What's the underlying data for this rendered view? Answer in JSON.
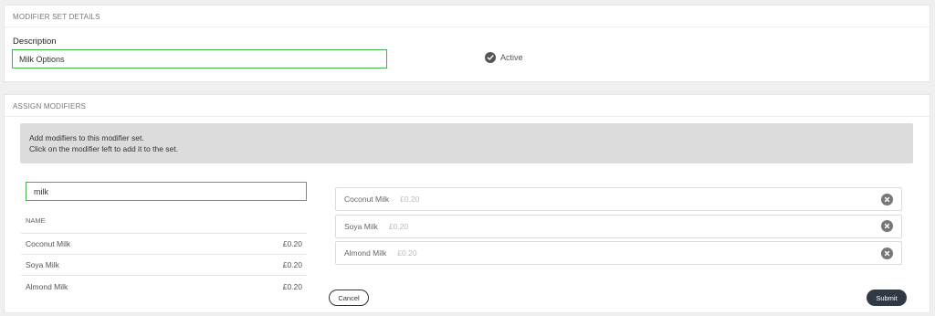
{
  "details": {
    "header": "MODIFIER SET DETAILS",
    "description_label": "Description",
    "description_value": "Milk Options",
    "active_label": "Active"
  },
  "assign": {
    "header": "ASSIGN MODIFIERS",
    "info_line1": "Add modifiers to this modifier set.",
    "info_line2": "Click on the modifier left to add it to the set.",
    "search_value": "milk",
    "list_header": "NAME",
    "available": [
      {
        "name": "Coconut Milk",
        "price": "£0.20"
      },
      {
        "name": "Soya Milk",
        "price": "£0.20"
      },
      {
        "name": "Almond Milk",
        "price": "£0.20"
      }
    ],
    "assigned": [
      {
        "name": "Coconut Milk",
        "price": "£0.20"
      },
      {
        "name": "Soya Milk",
        "price": "£0.20"
      },
      {
        "name": "Almond Milk",
        "price": "£0.20"
      }
    ],
    "cancel_label": "Cancel",
    "submit_label": "Submit"
  },
  "icons": {
    "active": "check-circle-icon",
    "remove": "remove-circle-icon"
  },
  "colors": {
    "focus_border": "#3fb54a",
    "submit_bg": "#2f3a45",
    "info_bg": "#dcdcdc"
  }
}
